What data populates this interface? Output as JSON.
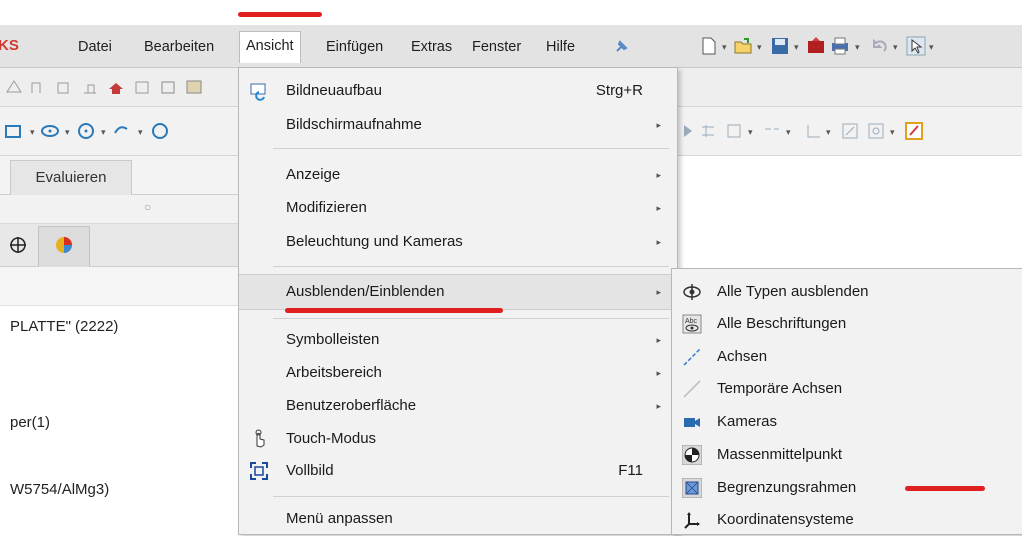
{
  "app": {
    "logo_fragment": "KS"
  },
  "menubar": {
    "items": [
      "Datei",
      "Bearbeiten",
      "Ansicht",
      "Einfügen",
      "Extras",
      "Fenster",
      "Hilfe"
    ],
    "active": "Ansicht"
  },
  "left_panel": {
    "tab": "Evaluieren",
    "tree": [
      "PLATTE\"  (2222)",
      "per(1)",
      "W5754/AlMg3)"
    ]
  },
  "menu": {
    "items": [
      {
        "label": "Bildneuaufbau",
        "shortcut": "Strg+R",
        "icon": "rebuild-icon"
      },
      {
        "label": "Bildschirmaufnahme",
        "submenu": true
      },
      {
        "label": "Anzeige",
        "submenu": true
      },
      {
        "label": "Modifizieren",
        "submenu": true
      },
      {
        "label": "Beleuchtung und Kameras",
        "submenu": true
      },
      {
        "label": "Ausblenden/Einblenden",
        "submenu": true,
        "highlighted": true
      },
      {
        "label": "Symbolleisten",
        "submenu": true
      },
      {
        "label": "Arbeitsbereich",
        "submenu": true
      },
      {
        "label": "Benutzeroberfläche",
        "submenu": true
      },
      {
        "label": "Touch-Modus",
        "icon": "touch-hand-icon"
      },
      {
        "label": "Vollbild",
        "shortcut": "F11",
        "icon": "fullscreen-icon"
      },
      {
        "label": "Menü anpassen"
      }
    ]
  },
  "submenu": {
    "items": [
      {
        "label": "Alle Typen ausblenden",
        "icon": "hide-all-types-icon"
      },
      {
        "label": "Alle Beschriftungen",
        "icon": "annotations-icon"
      },
      {
        "label": "Achsen",
        "icon": "axes-icon"
      },
      {
        "label": "Temporäre Achsen",
        "icon": "temp-axes-icon"
      },
      {
        "label": "Kameras",
        "icon": "camera-icon"
      },
      {
        "label": "Massenmittelpunkt",
        "icon": "center-of-mass-icon"
      },
      {
        "label": "Begrenzungsrahmen",
        "icon": "bounding-box-icon"
      },
      {
        "label": "Koordinatensysteme",
        "icon": "coordinate-system-icon"
      }
    ]
  },
  "colors": {
    "accent_underline": "#e02020",
    "logo": "#d23a2f"
  }
}
